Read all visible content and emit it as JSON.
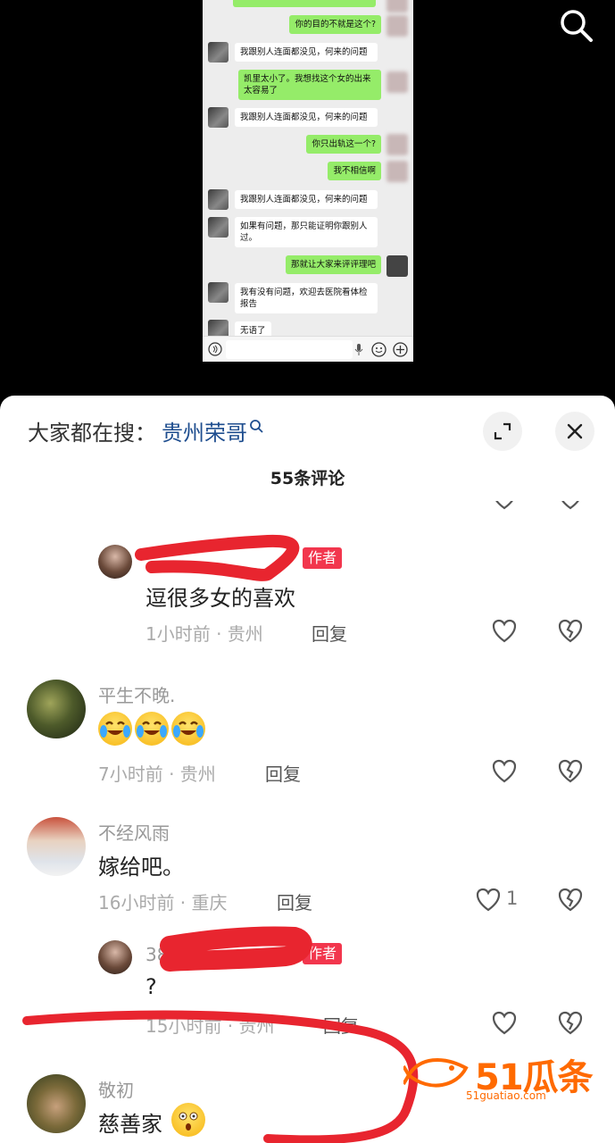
{
  "chat": {
    "messages": [
      {
        "side": "out",
        "text": "你的目的不就是这个?"
      },
      {
        "side": "in",
        "text": "我跟别人连面都没见，何来的问题"
      },
      {
        "side": "out",
        "text": "凯里太小了。我想找这个女的出来太容易了"
      },
      {
        "side": "in",
        "text": "我跟别人连面都没见，何来的问题"
      },
      {
        "side": "out",
        "text": "你只出轨这一个?"
      },
      {
        "side": "out",
        "text": "我不相信啊"
      },
      {
        "side": "in",
        "text": "我跟别人连面都没见，何来的问题"
      },
      {
        "side": "in",
        "text": "如果有问题，那只能证明你跟别人过。"
      },
      {
        "side": "out",
        "text": "那就让大家来评评理吧"
      },
      {
        "side": "in",
        "text": "我有没有问题，欢迎去医院看体检报告"
      },
      {
        "side": "in",
        "text": "无语了"
      }
    ]
  },
  "sheet": {
    "hot_prefix": "大家都在搜：",
    "hot_keyword": "贵州荣哥",
    "comment_count": "55条评论"
  },
  "comments": [
    {
      "type": "reply",
      "nick": "",
      "is_author": true,
      "author_tag": "作者",
      "text": "逗很多女的喜欢",
      "time": "1小时前 · 贵州",
      "reply": "回复",
      "likes": ""
    },
    {
      "type": "top",
      "nick": "平生不晚.",
      "is_author": false,
      "text": "",
      "emoji": [
        "crying-laughing",
        "crying-laughing",
        "crying-laughing"
      ],
      "time": "7小时前 · 贵州",
      "reply": "回复",
      "likes": ""
    },
    {
      "type": "top",
      "nick": "不经风雨",
      "is_author": false,
      "text": "嫁给吧。",
      "time": "16小时前 · 重庆",
      "reply": "回复",
      "likes": "1"
    },
    {
      "type": "reply",
      "nick": "38",
      "is_author": true,
      "author_tag": "作者",
      "text": "?",
      "time": "15小时前 · 贵州",
      "reply": "回复",
      "likes": ""
    },
    {
      "type": "top",
      "nick": "敬初",
      "is_author": false,
      "text": "慈善家",
      "time": "",
      "reply": "",
      "likes": ""
    }
  ],
  "watermark": {
    "brand": "51瓜条",
    "url": "51guatiao.com"
  },
  "colors": {
    "author_tag": "#f2364d",
    "hot_keyword": "#1f4e8f",
    "wechat_green": "#95ec69",
    "scribble": "#e8252f"
  }
}
